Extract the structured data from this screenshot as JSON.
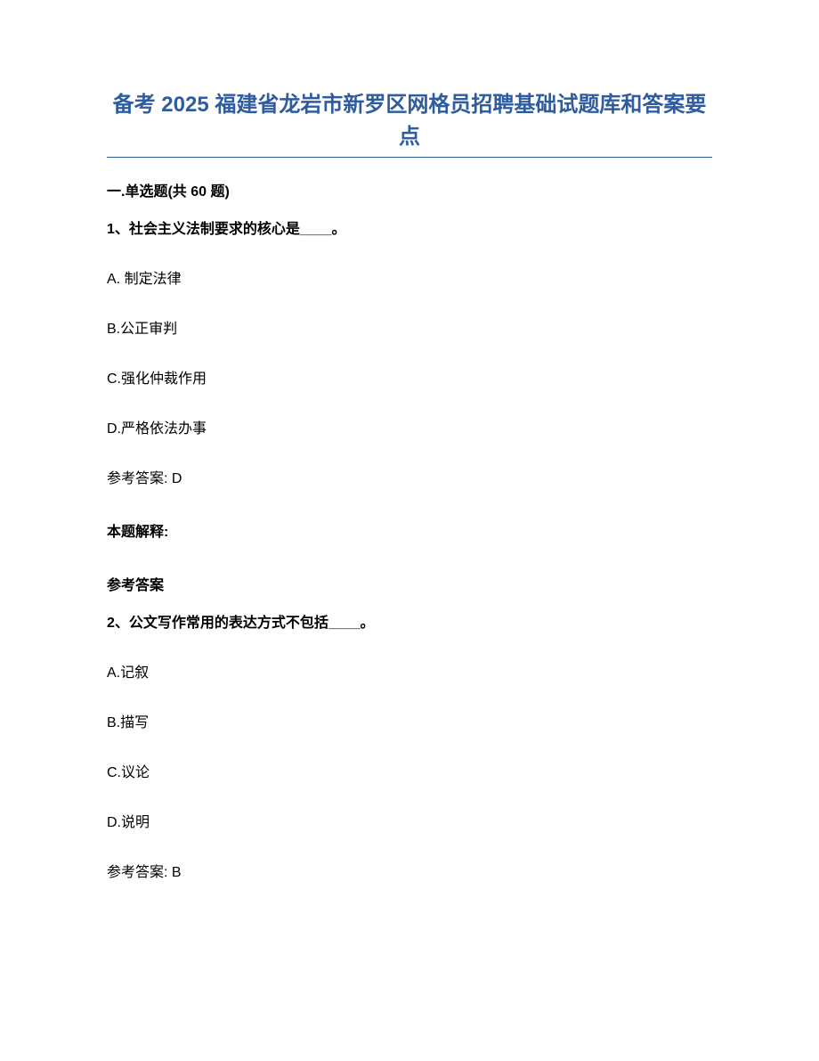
{
  "title": "备考 2025 福建省龙岩市新罗区网格员招聘基础试题库和答案要点",
  "section_header": "一.单选题(共 60 题)",
  "q1": {
    "text": "1、社会主义法制要求的核心是____。",
    "optA": "A. 制定法律",
    "optB": "B.公正审判",
    "optC": "C.强化仲裁作用",
    "optD": "D.严格依法办事",
    "answer": "参考答案: D",
    "explain_label": "本题解释:",
    "ref_answer": "参考答案"
  },
  "q2": {
    "text": "2、公文写作常用的表达方式不包括____。",
    "optA": "A.记叙",
    "optB": "B.描写",
    "optC": "C.议论",
    "optD": "D.说明",
    "answer": "参考答案: B"
  }
}
